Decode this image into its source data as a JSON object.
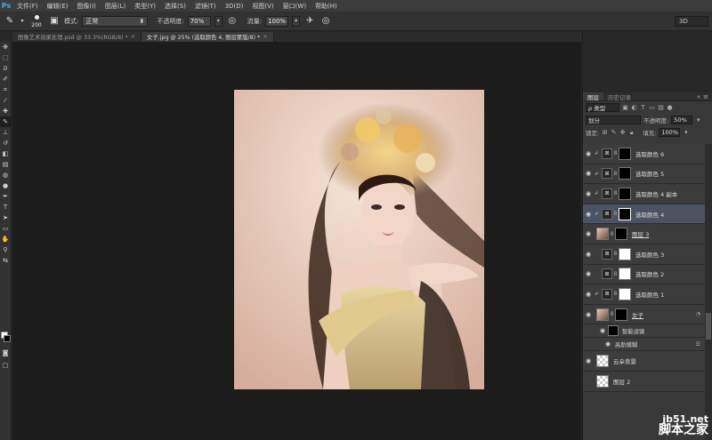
{
  "app": {
    "logo": "Ps"
  },
  "menu": [
    "文件(F)",
    "编辑(E)",
    "图像(I)",
    "图层(L)",
    "类型(Y)",
    "选择(S)",
    "滤镜(T)",
    "3D(D)",
    "视图(V)",
    "窗口(W)",
    "帮助(H)"
  ],
  "options": {
    "brush_size": "200",
    "mode_label": "模式:",
    "mode_value": "正常",
    "opacity_label": "不透明度:",
    "opacity_value": "70%",
    "flow_label": "流量:",
    "flow_value": "100%",
    "workspace": "3D"
  },
  "tabs": [
    {
      "label": "图像艺术效果处理.psd @ 33.3%(RGB/8) *"
    },
    {
      "label": "女子.jpg @ 25% (选取颜色 4, 图层蒙版/8) *"
    }
  ],
  "panel": {
    "tabs": [
      "图层",
      "历史记录"
    ],
    "filter_label": "ρ 类型",
    "blend_mode": "划分",
    "opacity_label": "不透明度:",
    "opacity_value": "50%",
    "lock_label": "锁定:",
    "fill_label": "填充:",
    "fill_value": "100%"
  },
  "layers": [
    {
      "name": "选取颜色 6",
      "visible": true,
      "clip": true,
      "mask": "black",
      "selected": false
    },
    {
      "name": "选取颜色 5",
      "visible": true,
      "clip": true,
      "mask": "black",
      "selected": false
    },
    {
      "name": "选取颜色 4 副本",
      "visible": true,
      "clip": true,
      "mask": "black",
      "selected": false
    },
    {
      "name": "选取颜色 4",
      "visible": true,
      "clip": true,
      "mask": "black",
      "selected": true
    },
    {
      "name": "图层 3",
      "visible": true,
      "clip": false,
      "mask": "black",
      "selected": false,
      "kind": "photo"
    },
    {
      "name": "选取颜色 3",
      "visible": true,
      "clip": false,
      "mask": "white",
      "selected": false
    },
    {
      "name": "选取颜色 2",
      "visible": true,
      "clip": false,
      "mask": "white",
      "selected": false
    },
    {
      "name": "选取颜色 1",
      "visible": true,
      "clip": true,
      "mask": "white",
      "selected": false
    },
    {
      "name": "女子",
      "visible": true,
      "clip": false,
      "mask": "black",
      "selected": false,
      "kind": "smart"
    }
  ],
  "smart_filters": {
    "label": "智能滤镜",
    "filter": "高斯模糊"
  },
  "bottom_layers": [
    {
      "name": "云朵背景",
      "visible": true
    },
    {
      "name": "图层 2",
      "visible": false
    }
  ],
  "watermark": {
    "line1": "jb51.net",
    "line2": "脚本之家"
  },
  "colors": {
    "accent": "#3fa9f5",
    "selected_layer": "#4b5363"
  }
}
